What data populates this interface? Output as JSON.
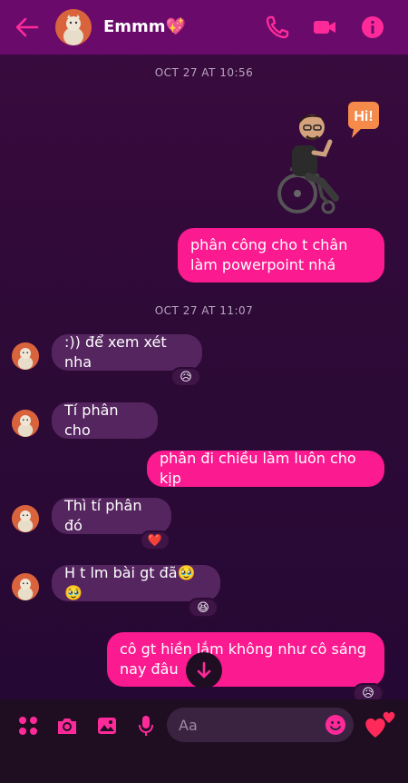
{
  "header": {
    "contact_name": "Emmm💖",
    "back_icon": "back-arrow-icon",
    "call_icon": "phone-icon",
    "video_icon": "video-camera-icon",
    "info_icon": "info-icon"
  },
  "timestamps": [
    "OCT 27 AT 10:56",
    "OCT 27 AT 11:07"
  ],
  "messages": [
    {
      "direction": "out",
      "text": "phân công cho t chân làm powerpoint nhá"
    },
    {
      "direction": "in",
      "text": ":)) để xem xét nha",
      "reaction": "😥"
    },
    {
      "direction": "in",
      "text": "Tí phân cho"
    },
    {
      "direction": "out",
      "text": "phân đi chiều làm luôn cho kịp"
    },
    {
      "direction": "in",
      "text": "Thì tí phân đó",
      "reaction": "❤️"
    },
    {
      "direction": "in",
      "text": "H t lm bài gt đã🥹🥹",
      "reaction": "😆"
    },
    {
      "direction": "out",
      "text": "cô gt hiền lắm không như cô sáng nay đâu",
      "reaction": "😥"
    }
  ],
  "sticker": {
    "badge": "Hi!"
  },
  "composer": {
    "placeholder": "Aa",
    "icons": [
      "more-apps-icon",
      "camera-icon",
      "gallery-icon",
      "microphone-icon",
      "emoji-icon",
      "heart-icon"
    ]
  },
  "colors": {
    "accent": "#fb1a8f",
    "header_bg": "#6a0b6b",
    "incoming_bubble": "#55255f",
    "background": "#2e0a37"
  }
}
